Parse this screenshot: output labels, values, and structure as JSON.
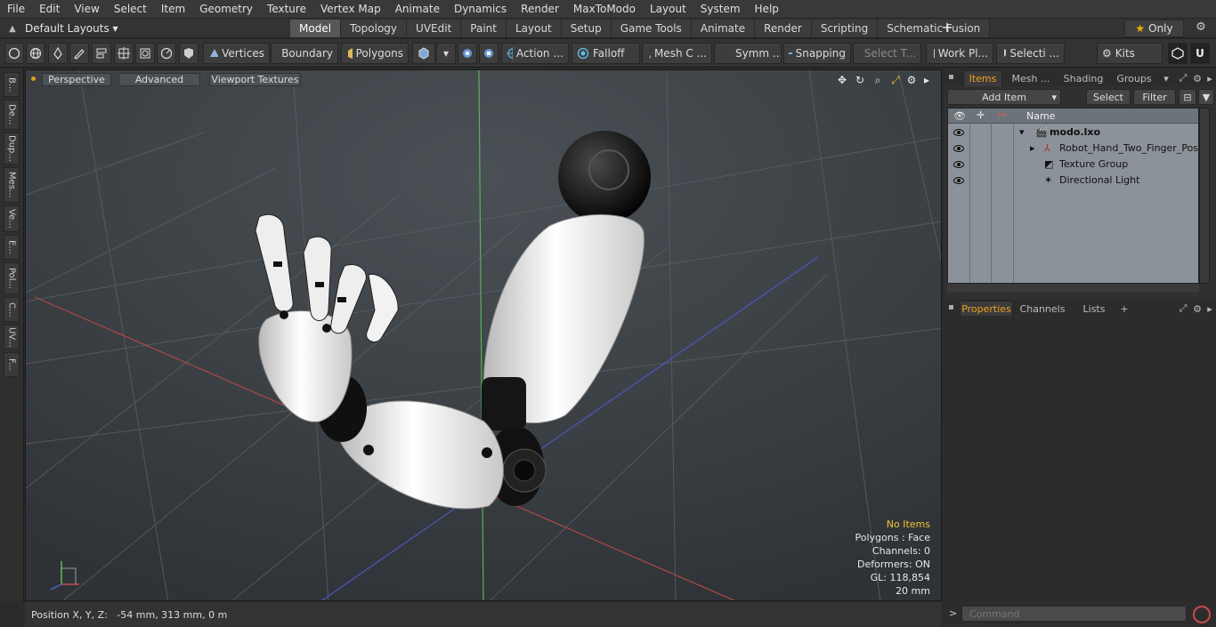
{
  "menu": [
    "File",
    "Edit",
    "View",
    "Select",
    "Item",
    "Geometry",
    "Texture",
    "Vertex Map",
    "Animate",
    "Dynamics",
    "Render",
    "MaxToModo",
    "Layout",
    "System",
    "Help"
  ],
  "layouts": {
    "label": "Default Layouts ▾"
  },
  "tabs": [
    "Model",
    "Topology",
    "UVEdit",
    "Paint",
    "Layout",
    "Setup",
    "Game Tools",
    "Animate",
    "Render",
    "Scripting",
    "Schematic Fusion"
  ],
  "active_tab": "Model",
  "only_label": "Only",
  "toolbar": {
    "vertices": "Vertices",
    "boundary": "Boundary",
    "polygons": "Polygons",
    "action": "Action",
    "falloff": "Falloff",
    "mesh": "Mesh C ...",
    "symm": "Symm ...",
    "snapping": "Snapping",
    "select_t": "Select T...",
    "work_pl": "Work Pl...",
    "selecti": "Selecti ...",
    "kits": "Kits"
  },
  "left_tabs": [
    "B...",
    "De...",
    "Dup...",
    "Mes...",
    "Ve...",
    "E...",
    "Pol...",
    "C...",
    "UV...",
    "F..."
  ],
  "viewport": {
    "perspective": "Perspective",
    "advanced": "Advanced",
    "viewport_textures": "Viewport Textures",
    "stats": {
      "no_items": "No Items",
      "polygons": "Polygons : Face",
      "channels": "Channels: 0",
      "deformers": "Deformers: ON",
      "gl": "GL: 118,854",
      "scale": "20 mm"
    }
  },
  "status": {
    "position": "Position X, Y, Z:   -54 mm, 313 mm, 0 m"
  },
  "panel": {
    "tabs": [
      "Items",
      "Mesh ...",
      "Shading",
      "Groups"
    ],
    "add_item": "Add Item",
    "select": "Select",
    "filter": "Filter",
    "name_header": "Name",
    "items": [
      {
        "label": "modo.lxo",
        "bold": true
      },
      {
        "label": "Robot_Hand_Two_Finger_Pose"
      },
      {
        "label": "Texture Group"
      },
      {
        "label": "Directional Light"
      }
    ],
    "bottom_tabs": [
      "Properties",
      "Channels",
      "Lists"
    ],
    "command_placeholder": "Command"
  },
  "colors": {
    "accent": "#f0a020",
    "viewport": "#3c4146"
  }
}
